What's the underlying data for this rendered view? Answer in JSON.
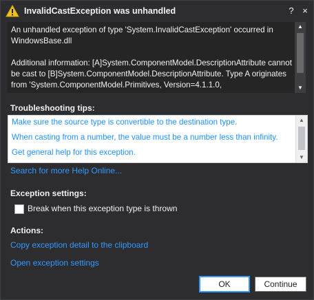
{
  "window": {
    "title": "InvalidCastException was unhandled",
    "help_label": "?",
    "close_label": "×"
  },
  "message": {
    "text": "An unhandled exception of type 'System.InvalidCastException' occurred in WindowsBase.dll\n\nAdditional information: [A]System.ComponentModel.DescriptionAttribute cannot be cast to [B]System.ComponentModel.DescriptionAttribute. Type A originates from 'System.ComponentModel.Primitives, Version=4.1.1.0,"
  },
  "troubleshooting": {
    "header": "Troubleshooting tips:",
    "tips": [
      "Make sure the source type is convertible to the destination type.",
      "When casting from a number, the value must be a number less than infinity.",
      "Get general help for this exception."
    ],
    "search_link": "Search for more Help Online..."
  },
  "exception_settings": {
    "header": "Exception settings:",
    "checkbox_label": "Break when this exception type is thrown",
    "checked": false
  },
  "actions": {
    "header": "Actions:",
    "copy_link": "Copy exception detail to the clipboard",
    "open_link": "Open exception settings"
  },
  "buttons": {
    "ok": "OK",
    "continue": "Continue"
  },
  "colors": {
    "background": "#2d2d30",
    "panel": "#252526",
    "link": "#3399ff",
    "warning": "#f2c31e"
  }
}
